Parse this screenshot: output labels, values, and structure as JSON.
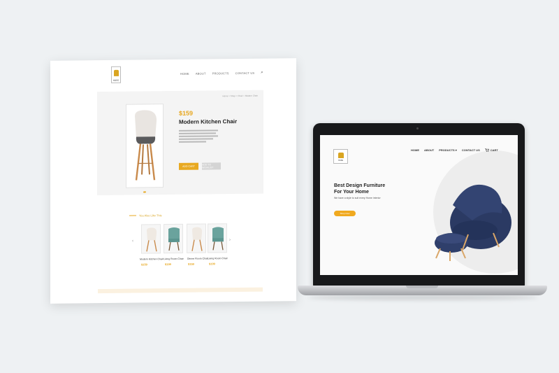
{
  "colors": {
    "accent": "#e8a921",
    "navy": "#2b3a63",
    "wood": "#c98a4b",
    "background": "#eef1f3"
  },
  "desktop_page": {
    "logo_text": "HOPE",
    "nav": [
      "HOME",
      "ABOUT",
      "PRODUCTS",
      "CONTACT US"
    ],
    "search_icon": "search-icon",
    "breadcrumb": "Home > Shop > Chair > Modern Chair",
    "product": {
      "price": "$159",
      "name": "Modern Kitchen Chair",
      "add_to_cart_label": "ADD CART",
      "wishlist_label": "ADD TO WISHLIST"
    },
    "similar": {
      "title": "You Also Like This",
      "items": [
        {
          "name": "Modern Kitchen Chair",
          "price": "$159"
        },
        {
          "name": "Living Room Chair",
          "price": "$199"
        },
        {
          "name": "Dinner Room Chair",
          "price": "$159"
        },
        {
          "name": "Living Room Chair",
          "price": "$199"
        }
      ]
    }
  },
  "laptop_site": {
    "logo_text": "HOPE",
    "nav": [
      "HOME",
      "ABOUT",
      "PRODUCTS ▾",
      "CONTACT US",
      "CART"
    ],
    "hero": {
      "title_line1": "Best Design Furniture",
      "title_line2": "For Your Home",
      "subtitle": "We have a style to suit every Home interior",
      "button": "Shop Now"
    }
  }
}
